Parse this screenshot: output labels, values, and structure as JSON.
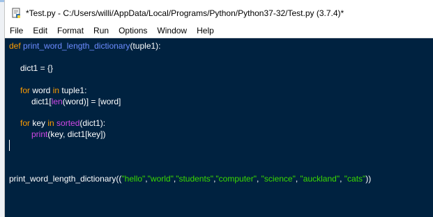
{
  "window": {
    "title": "*Test.py - C:/Users/willi/AppData/Local/Programs/Python/Python37-32/Test.py (3.7.4)*"
  },
  "menu": [
    "File",
    "Edit",
    "Format",
    "Run",
    "Options",
    "Window",
    "Help"
  ],
  "code": {
    "l1_kw": "def",
    "l1_fn": "print_word_length_dictionary",
    "l1_rest": "(tuple1):",
    "l2": "dict1 = {}",
    "l3_kw1": "for",
    "l3_mid": " word ",
    "l3_kw2": "in",
    "l3_rest": " tuple1:",
    "l4_a": "dict1[",
    "l4_bi": "len",
    "l4_b": "(word)] = [word]",
    "l5_kw1": "for",
    "l5_mid": " key ",
    "l5_kw2": "in",
    "l5_sp": " ",
    "l5_bi": "sorted",
    "l5_rest": "(dict1):",
    "l6_bi": "print",
    "l6_rest": "(key, dict1[key])",
    "call_fn": "print_word_length_dictionary((",
    "s1": "\"hello\"",
    "c1": ",",
    "s2": "\"world\"",
    "c2": ",",
    "s3": "\"students\"",
    "c3": ",",
    "s4": "\"computer\"",
    "c4": ", ",
    "s5": "\"science\"",
    "c5": ", ",
    "s6": "\"auckland\"",
    "c6": ", ",
    "s7": "\"cats\"",
    "call_end": "))"
  },
  "colors": {
    "editor_bg": "#002240",
    "keyword": "#ff9d00",
    "def_name": "#6c8cff",
    "builtin": "#d148e6",
    "string": "#3ad900"
  }
}
